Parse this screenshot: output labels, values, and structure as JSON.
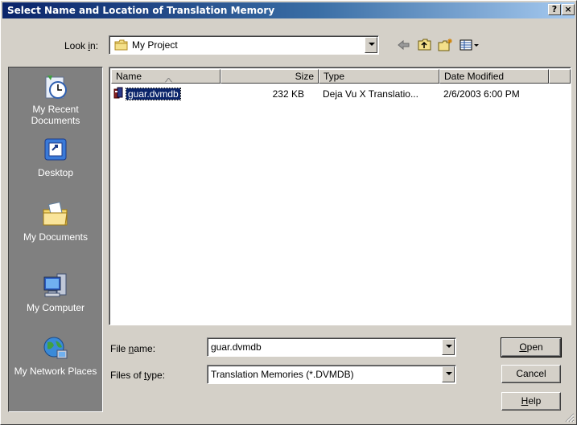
{
  "window": {
    "title": "Select Name and Location of Translation Memory",
    "help_button": "?",
    "close_button": "×"
  },
  "lookin": {
    "label_pre": "Look ",
    "label_accel": "i",
    "label_post": "n:",
    "value": "My Project"
  },
  "toolbar": {
    "back_icon": "back-arrow-icon",
    "up_icon": "up-folder-icon",
    "new_folder_icon": "new-folder-icon",
    "view_menu_icon": "view-menu-icon"
  },
  "places": [
    {
      "label": "My Recent Documents",
      "icon": "recent-documents-icon"
    },
    {
      "label": "Desktop",
      "icon": "desktop-icon"
    },
    {
      "label": "My Documents",
      "icon": "my-documents-icon"
    },
    {
      "label": "My Computer",
      "icon": "my-computer-icon"
    },
    {
      "label": "My Network Places",
      "icon": "network-places-icon"
    }
  ],
  "list": {
    "columns": [
      "Name",
      "Size",
      "Type",
      "Date Modified"
    ],
    "sort_column": "Name",
    "sort_direction": "ascending",
    "rows": [
      {
        "name": "guar.dvmdb",
        "size": "232 KB",
        "type": "Deja Vu X Translatio...",
        "date": "2/6/2003 6:00 PM",
        "selected": true
      }
    ]
  },
  "filename": {
    "label_pre": "File ",
    "label_accel": "n",
    "label_post": "ame:",
    "value": "guar.dvmdb"
  },
  "filetype": {
    "label_pre": "Files of ",
    "label_accel": "t",
    "label_post": "ype:",
    "value": "Translation Memories (*.DVMDB)"
  },
  "buttons": {
    "open_accel": "O",
    "open_rest": "pen",
    "cancel": "Cancel",
    "help_accel": "H",
    "help_rest": "elp"
  },
  "colors": {
    "title_gradient_start": "#0a246a",
    "title_gradient_end": "#a6caf0",
    "selection": "#0a246a",
    "dialog_face": "#d4d0c8",
    "places_bar": "#808080"
  }
}
